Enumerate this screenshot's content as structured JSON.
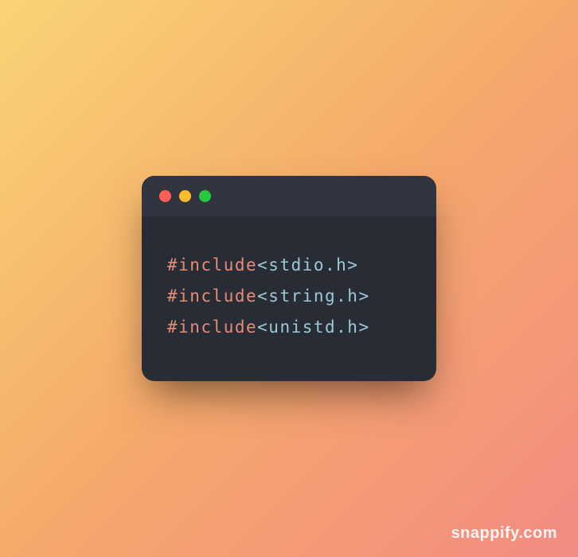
{
  "code": {
    "lines": [
      {
        "directive": "#include",
        "path": "<stdio.h>"
      },
      {
        "directive": "#include",
        "path": "<string.h>"
      },
      {
        "directive": "#include",
        "path": "<unistd.h>"
      }
    ]
  },
  "watermark": "snappify.com",
  "colors": {
    "window_bg": "#282c34",
    "titlebar_bg": "#31353f",
    "preprocessor": "#e78c78",
    "include_path": "#9ec8d8",
    "traffic_red": "#ff5f56",
    "traffic_yellow": "#ffbd2e",
    "traffic_green": "#27c93f"
  }
}
